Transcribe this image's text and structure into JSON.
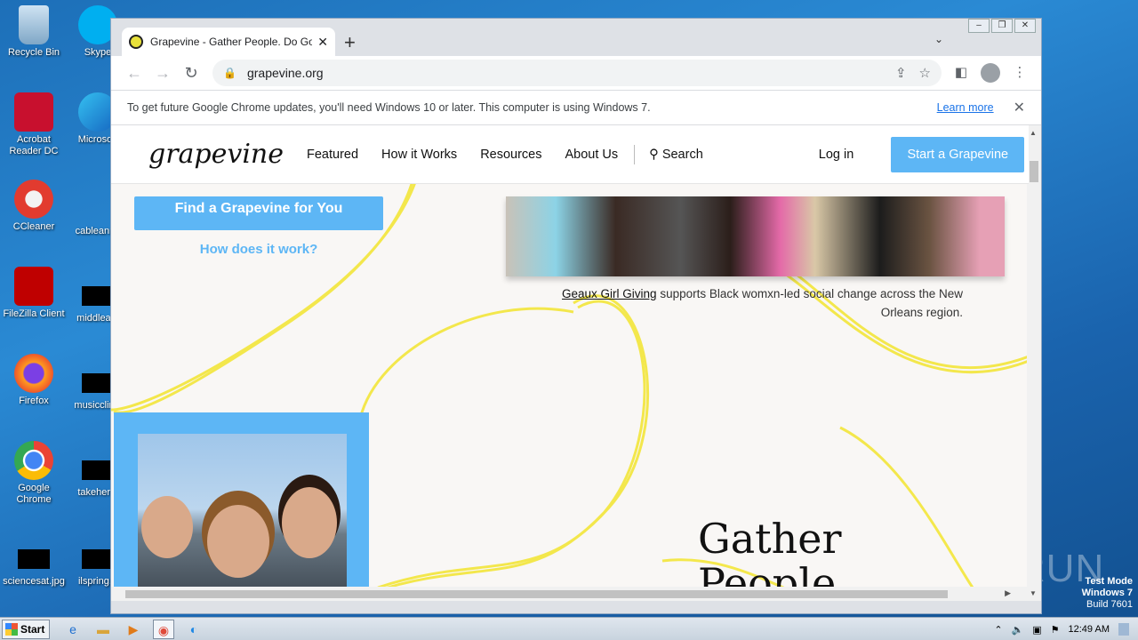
{
  "desktop": {
    "icons_left": [
      {
        "label": "Recycle Bin"
      },
      {
        "label": "Acrobat Reader DC"
      },
      {
        "label": "CCleaner"
      },
      {
        "label": "FileZilla Client"
      },
      {
        "label": "Firefox"
      },
      {
        "label": "Google Chrome"
      },
      {
        "label": "sciencesat.jpg"
      }
    ],
    "icons_right": [
      {
        "label": "Skype"
      },
      {
        "label": "Microsoft"
      },
      {
        "label": "cableannu"
      },
      {
        "label": "middleam"
      },
      {
        "label": "musicclinic"
      },
      {
        "label": "takeher..."
      },
      {
        "label": "ilspring..."
      }
    ]
  },
  "browser": {
    "tab_title": "Grapevine - Gather People. Do Good",
    "url": "grapevine.org",
    "infobar": {
      "message": "To get future Google Chrome updates, you'll need Windows 10 or later. This computer is using Windows 7.",
      "learn_more": "Learn more"
    }
  },
  "site": {
    "logo": "grapevine",
    "nav": [
      "Featured",
      "How it Works",
      "Resources",
      "About Us"
    ],
    "search": "Search",
    "login": "Log in",
    "start_button": "Start a Grapevine",
    "find_button": "Find a Grapevine for You",
    "how_link": "How does it work?",
    "caption_link": "Geaux Girl Giving",
    "caption_text": " supports Black womxn-led social change across the New Orleans region.",
    "headline_line1": "Gather",
    "headline_line2": "People."
  },
  "taskbar": {
    "start": "Start",
    "clock": "12:49 AM"
  },
  "watermark": {
    "line1": "Test Mode",
    "line2": "Windows 7",
    "line3": "Build 7601",
    "brand": "ANY RUN"
  }
}
